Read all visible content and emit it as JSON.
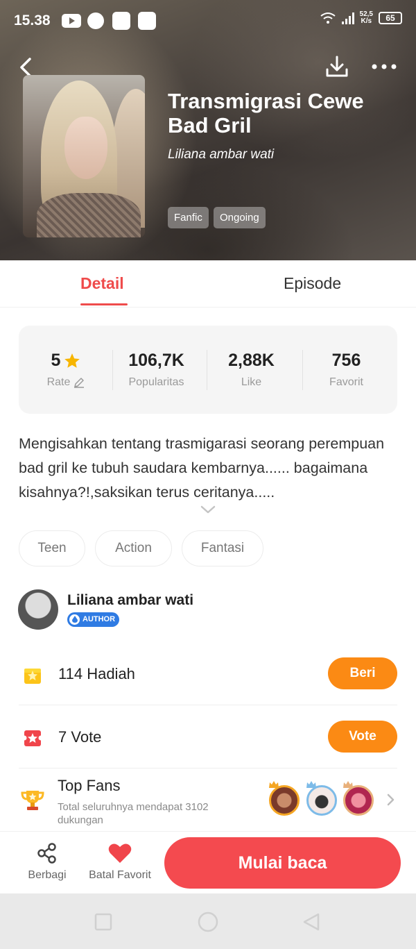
{
  "status_bar": {
    "time": "15.38",
    "speed_value": "52,5",
    "speed_unit": "K/s",
    "battery": "65"
  },
  "book": {
    "title": "Transmigrasi Cewe Bad Gril",
    "author": "Liliana ambar wati",
    "tags": [
      "Fanfic",
      "Ongoing"
    ]
  },
  "tabs": {
    "detail": "Detail",
    "episode": "Episode"
  },
  "stats": {
    "rate": {
      "value": "5",
      "label": "Rate"
    },
    "popularity": {
      "value": "106,7K",
      "label": "Popularitas"
    },
    "like": {
      "value": "2,88K",
      "label": "Like"
    },
    "favorite": {
      "value": "756",
      "label": "Favorit"
    }
  },
  "description": "Mengisahkan tentang trasmigarasi seorang perempuan bad gril ke tubuh saudara kembarnya...... bagaimana kisahnya?!,saksikan terus ceritanya.....",
  "genres": [
    "Teen",
    "Action",
    "Fantasi"
  ],
  "author_card": {
    "name": "Liliana ambar wati",
    "badge": "AUTHOR"
  },
  "gifts": {
    "count": "114",
    "label": "Hadiah",
    "button": "Beri"
  },
  "votes": {
    "count": "7",
    "label": "Vote",
    "button": "Vote"
  },
  "top_fans": {
    "title": "Top Fans",
    "subtitle": "Total seluruhnya mendapat 3102 dukungan"
  },
  "bottom_bar": {
    "share": "Berbagi",
    "unfavorite": "Batal Favorit",
    "start": "Mulai baca"
  },
  "colors": {
    "accent": "#ef4b4b",
    "orange": "#fb8a14",
    "badge_blue": "#2f7be3",
    "star": "#f7b500"
  },
  "icons": [
    "back-icon",
    "download-icon",
    "more-icon",
    "star-icon",
    "edit-icon",
    "chevron-down-icon",
    "gift-icon",
    "vote-icon",
    "trophy-icon",
    "chevron-right-icon",
    "share-icon",
    "heart-icon"
  ]
}
